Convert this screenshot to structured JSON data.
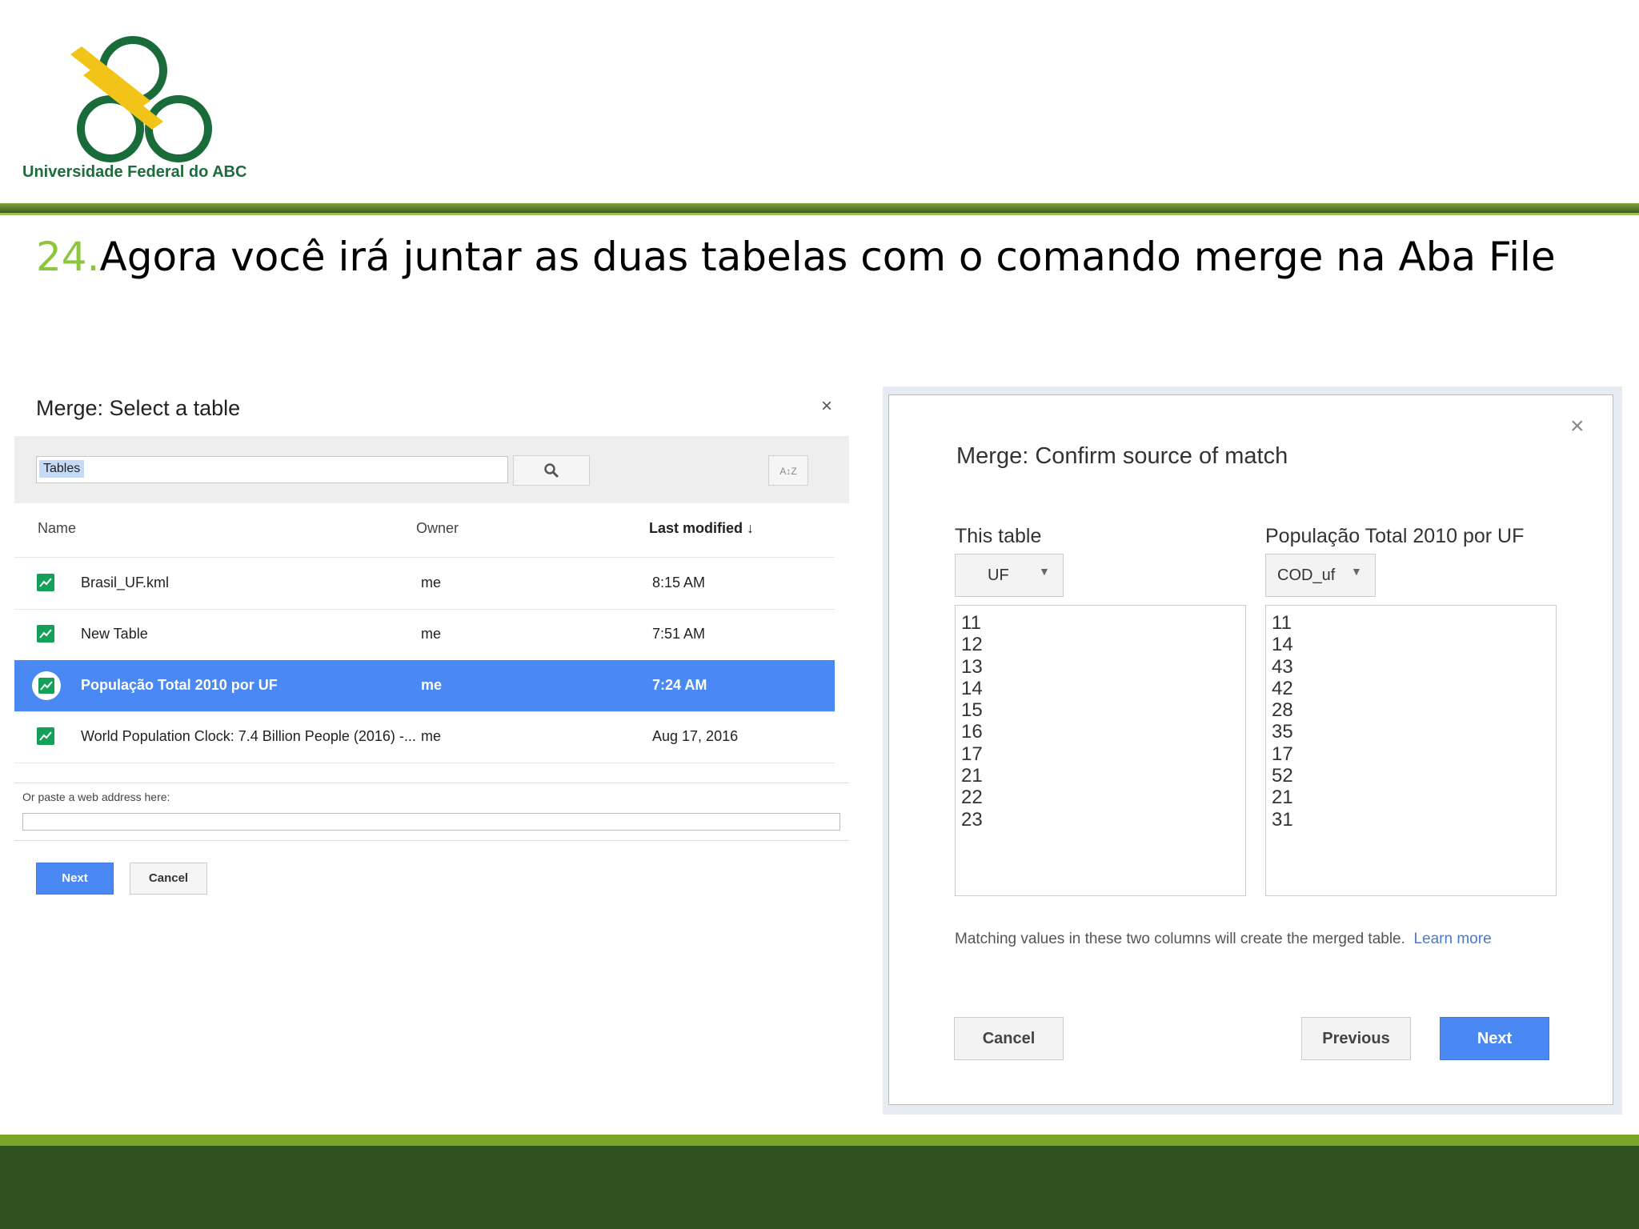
{
  "logo": {
    "text": "Universidade Federal do ABC"
  },
  "heading": {
    "number": "24.",
    "text": "Agora você irá juntar as duas tabelas com o comando merge na Aba File"
  },
  "select_dialog": {
    "title": "Merge: Select a table",
    "close": "×",
    "search_value": "Tables",
    "sort_icon_text": "A↕Z",
    "columns": {
      "name": "Name",
      "owner": "Owner",
      "modified": "Last modified ↓"
    },
    "rows": [
      {
        "name": "Brasil_UF.kml",
        "owner": "me",
        "modified": "8:15 AM"
      },
      {
        "name": "New Table",
        "owner": "me",
        "modified": "7:51 AM"
      },
      {
        "name": "População Total 2010 por UF",
        "owner": "me",
        "modified": "7:24 AM",
        "selected": true
      },
      {
        "name": "World Population Clock: 7.4 Billion People (2016) -...",
        "owner": "me",
        "modified": "Aug 17, 2016"
      }
    ],
    "paste_label": "Or paste a web address here:",
    "next": "Next",
    "cancel": "Cancel"
  },
  "confirm_dialog": {
    "close": "×",
    "title": "Merge: Confirm source of match",
    "left_header": "This table",
    "left_column": "UF",
    "left_values": [
      "11",
      "12",
      "13",
      "14",
      "15",
      "16",
      "17",
      "21",
      "22",
      "23"
    ],
    "right_header": "População Total 2010 por UF",
    "right_column": "COD_uf",
    "right_values": [
      "11",
      "14",
      "43",
      "42",
      "28",
      "35",
      "17",
      "52",
      "21",
      "31"
    ],
    "note": "Matching values in these two columns will create the merged table.",
    "learn_more": "Learn more",
    "cancel": "Cancel",
    "previous": "Previous",
    "next": "Next"
  },
  "colors": {
    "accent_green": "#8cc63f",
    "footer_green": "#2f5220",
    "select_blue": "#4a89f3"
  }
}
